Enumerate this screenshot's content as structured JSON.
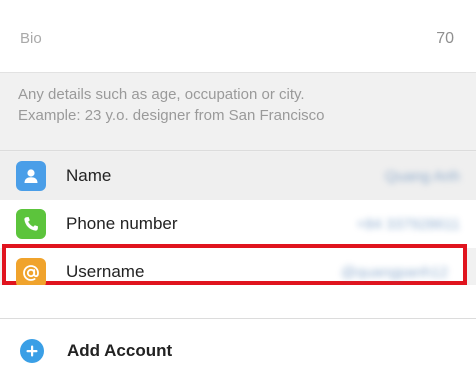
{
  "bio": {
    "label": "Bio",
    "remaining": "70"
  },
  "hint": {
    "line1": "Any details such as age, occupation or city.",
    "line2": "Example: 23 y.o. designer from San Francisco"
  },
  "rows": [
    {
      "label": "Name",
      "value": "Quang Anh",
      "icon": "person-icon",
      "color": "#4a9ee8"
    },
    {
      "label": "Phone number",
      "value": "+84 337928611",
      "icon": "phone-icon",
      "color": "#5cc43c"
    },
    {
      "label": "Username",
      "value": "@quangpanh12",
      "icon": "at-sign-icon",
      "color": "#f0a32c"
    }
  ],
  "add_account": {
    "label": "Add Account",
    "icon": "plus-circle-icon",
    "color": "#3a9fe6"
  },
  "highlight_color": "#e0141e"
}
